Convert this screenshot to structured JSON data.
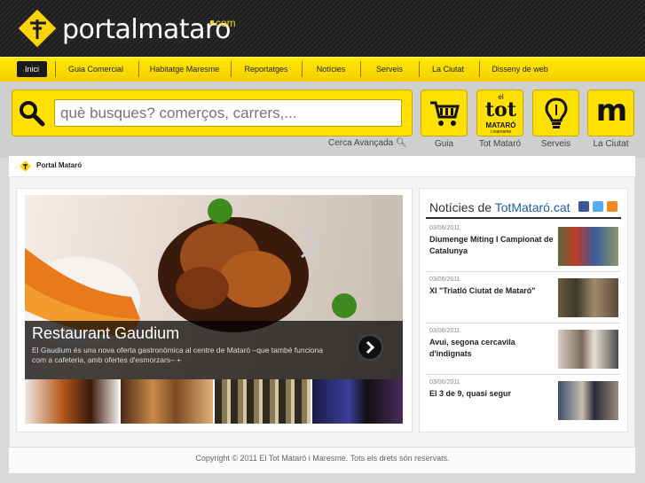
{
  "header": {
    "logo_main": "portalmataro",
    "logo_suffix": "com"
  },
  "nav": {
    "items": [
      "Inici",
      "Guia Comercial",
      "Habitatge Maresme",
      "Reportatges",
      "Notícies",
      "Serveis",
      "La Ciutat",
      "Disseny de web"
    ],
    "active": "Inici"
  },
  "search": {
    "placeholder": "què busques? comerços, carrers,...",
    "advanced_label": "Cerca Avançada"
  },
  "tiles": [
    {
      "label": "Guia",
      "icon": "cart-icon"
    },
    {
      "label": "Tot Mataró",
      "icon": "tot-mataro-logo",
      "logo_top": "el",
      "logo_main": "tot",
      "logo_sub": "MATARÓ",
      "logo_tiny": "i maresme"
    },
    {
      "label": "Serveis",
      "icon": "lightbulb-icon"
    },
    {
      "label": "La Ciutat",
      "icon": "m-logo-icon",
      "logo_letter": "m"
    }
  ],
  "breadcrumb": {
    "text": "Portal Mataró"
  },
  "featured": {
    "title": "Restaurant Gaudium",
    "text": "El Gaudium és una nova oferta gastronòmica al centre de Mataró –que també funciona com a cafeteria, amb ofertes d'esmorzars– +"
  },
  "news": {
    "heading_prefix": "Notícies de",
    "heading_brand": "TotMataró.cat",
    "items": [
      {
        "date": "03/06/2011",
        "headline": "Diumenge Míting I Campionat de Catalunya"
      },
      {
        "date": "03/06/2011",
        "headline": "XI \"Triatló Ciutat de Mataró\""
      },
      {
        "date": "03/06/2011",
        "headline": "Avui, segona cercavila d'indignats"
      },
      {
        "date": "03/06/2011",
        "headline": "El 3 de 9, quasi segur"
      }
    ]
  },
  "footer": {
    "text": "Copyright © 2011 El Tot Mataró i Maresme. Tots els drets són reservats."
  },
  "colors": {
    "brand_yellow": "#ffe000",
    "header_dark": "#222222",
    "link_blue": "#1f5fa6"
  }
}
